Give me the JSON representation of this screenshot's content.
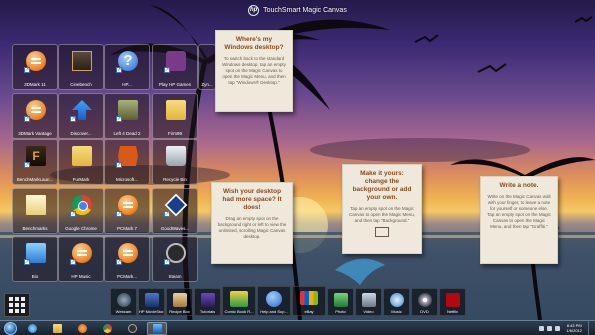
{
  "window": {
    "title": "TouchSmart Magic Canvas",
    "logo_text": "hp"
  },
  "desktop_icons": [
    {
      "label": "3DMark 11",
      "icon": "orange-app-icon"
    },
    {
      "label": "Cinebench",
      "icon": "folder-icon"
    },
    {
      "label": "HP...",
      "icon": "help-icon"
    },
    {
      "label": "Play HP Games",
      "icon": "games-icon"
    },
    {
      "label": "Zyn...",
      "icon": "app-icon"
    },
    {
      "label": "3DMark Vantage",
      "icon": "orange-app-icon"
    },
    {
      "label": "Discover...",
      "icon": "arrow-up-icon"
    },
    {
      "label": "Left 4 Dead 2",
      "icon": "game-icon"
    },
    {
      "label": "Firm99",
      "icon": "folder-icon"
    },
    {
      "label": "BenchMarkLaun...",
      "icon": "benchmark-icon"
    },
    {
      "label": "FurMark",
      "icon": "folder-icon"
    },
    {
      "label": "Microsoft...",
      "icon": "office-icon"
    },
    {
      "label": "Recycle Bin",
      "icon": "recycle-bin-icon"
    },
    {
      "label": "Benchmarks",
      "icon": "file-icon"
    },
    {
      "label": "Google Chrome",
      "icon": "chrome-icon"
    },
    {
      "label": "PCMark 7",
      "icon": "orange-app-icon"
    },
    {
      "label": "GoodWaves...",
      "icon": "diamond-icon"
    },
    {
      "label": "Bio",
      "icon": "document-icon"
    },
    {
      "label": "HP Music",
      "icon": "orange-app-icon"
    },
    {
      "label": "PCMark...",
      "icon": "orange-app-icon"
    },
    {
      "label": "Steam",
      "icon": "steam-icon"
    }
  ],
  "notes": [
    {
      "title": "Where's my Windows desktop?",
      "body": "To switch back to the standard Windows desktop, tap an empty spot on the Magic Canvas to open the Magic Menu, and then tap \"Windows® Desktop.\""
    },
    {
      "title": "Wish your desktop had more space? It does!",
      "body": "Drag an empty spot on the background right or left to view the unlimited, scrolling Magic Canvas desktop."
    },
    {
      "title": "Make it yours: change the background or add your own.",
      "body": "Tap an empty spot on the Magic Canvas to open the Magic Menu, and then tap \"Background.\""
    },
    {
      "title": "Write a note.",
      "body": "Write on the Magic Canvas wall with your finger, to leave a note for yourself or someone else. Tap an empty spot on the Magic Canvas to open the Magic Menu, and then tap \"Graffiti.\""
    }
  ],
  "dock": [
    {
      "label": "Webcam",
      "icon": "webcam-icon"
    },
    {
      "label": "HP MovieStor...",
      "icon": "movie-icon"
    },
    {
      "label": "Recipe Box",
      "icon": "recipe-icon"
    },
    {
      "label": "Tutorials",
      "icon": "tutorials-icon"
    },
    {
      "label": "Comic Book R...",
      "icon": "comic-book-icon"
    },
    {
      "label": "Help and Sup...",
      "icon": "help-icon"
    },
    {
      "label": "eBay",
      "icon": "ebay-icon"
    },
    {
      "label": "Photo",
      "icon": "photo-icon"
    },
    {
      "label": "Video",
      "icon": "video-icon"
    },
    {
      "label": "Music",
      "icon": "music-icon"
    },
    {
      "label": "DVD",
      "icon": "dvd-icon"
    },
    {
      "label": "Netflix",
      "icon": "netflix-icon"
    }
  ],
  "taskbar": {
    "apps": [
      "ie-icon",
      "explorer-icon",
      "media-player-icon",
      "chrome-icon",
      "steam-icon",
      "touchsmart-icon"
    ],
    "clock_time": "8:43 PM",
    "clock_date": "1/6/2012"
  },
  "colors": {
    "sunset_top": "#241a4a",
    "sunset_glow": "#f0b252",
    "sea": "#2c3f55",
    "note_paper": "#efe9dc"
  }
}
